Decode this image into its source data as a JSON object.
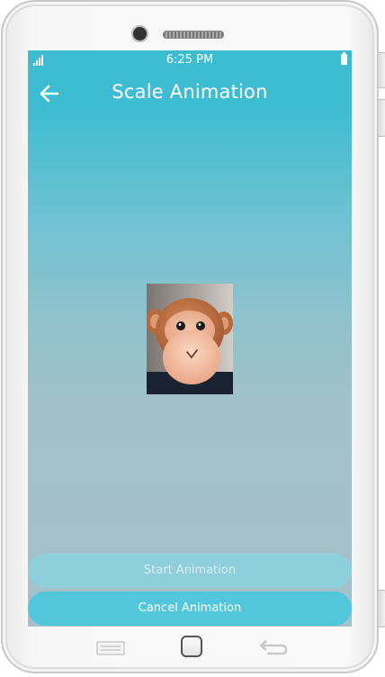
{
  "status_bar": {
    "time": "6:25 PM",
    "signal_icon": "signal-icon",
    "battery_icon": "battery-icon"
  },
  "app_bar": {
    "title": "Scale Animation",
    "back_icon": "arrow-left-icon"
  },
  "image": {
    "subject": "monkey-plush-photo"
  },
  "buttons": {
    "start_label": "Start Animation",
    "cancel_label": "Cancel Animation"
  },
  "nav_bar": {
    "recent_icon": "recent-apps-icon",
    "home_icon": "home-icon",
    "back_icon": "back-icon"
  },
  "colors": {
    "accent": "#3dbbd1",
    "button_start": "#8fcfdc",
    "button_cancel": "#52c7dc",
    "text_on_accent": "#ffffff"
  }
}
